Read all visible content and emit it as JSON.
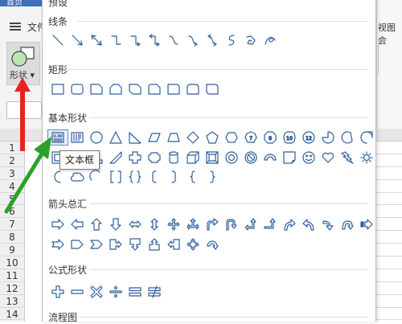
{
  "app": {
    "home_tab": "首页",
    "menu_text": "文件",
    "shape_button_label": "形状",
    "row_numbers": [
      "1",
      "2",
      "3",
      "4",
      "5",
      "6",
      "7",
      "8",
      "9",
      "10",
      "11",
      "12",
      "13",
      "14"
    ],
    "right_view_text": "视图",
    "right_extra": "会"
  },
  "panel": {
    "top_label": "预设",
    "sections": [
      {
        "title": "线条",
        "icons": [
          "line-icon",
          "arrow-line-icon",
          "double-arrow-line-icon",
          "elbow-connector-icon",
          "elbow-arrow-connector-icon",
          "elbow-double-arrow-icon",
          "curved-connector-icon",
          "curved-arrow-connector-icon",
          "curved-double-arrow-icon",
          "curve-icon",
          "freeform-icon",
          "scribble-icon"
        ]
      },
      {
        "title": "矩形",
        "icons": [
          "rectangle-icon",
          "rounded-rectangle-icon",
          "snip-corner-rectangle-icon",
          "snip-same-side-rectangle-icon",
          "snip-diagonal-rectangle-icon",
          "snip-round-rectangle-icon",
          "round-corner-rectangle-icon",
          "round-same-side-rectangle-icon",
          "round-diagonal-rectangle-icon"
        ]
      },
      {
        "title": "基本形状",
        "icons": [
          "text-box-icon",
          "vertical-text-box-icon",
          "oval-icon",
          "triangle-icon",
          "right-triangle-icon",
          "parallelogram-icon",
          "trapezoid-icon",
          "diamond-icon",
          "pentagon-icon",
          "hexagon-icon",
          "heptagon-icon",
          "octagon-icon",
          "decagon-icon",
          "dodecagon-icon",
          "pie-icon",
          "chord-icon",
          "teardrop-icon",
          "frame-icon",
          "half-frame-icon",
          "l-shape-icon",
          "diagonal-stripe-icon",
          "cross-icon",
          "plaque-icon",
          "can-icon",
          "cube-icon",
          "bevel-icon",
          "donut-icon",
          "no-symbol-icon",
          "block-arc-icon",
          "folded-corner-icon",
          "smiley-face-icon",
          "heart-icon",
          "lightning-bolt-icon",
          "sun-icon",
          "moon-icon",
          "cloud-icon",
          "arc-icon",
          "double-bracket-icon",
          "double-brace-icon",
          "left-bracket-icon",
          "right-bracket-icon",
          "left-brace-icon",
          "right-brace-icon"
        ]
      },
      {
        "title": "箭头总汇",
        "icons": []
      },
      {
        "title": "公式形状",
        "icons": []
      },
      {
        "title": "流程图",
        "icons": []
      }
    ],
    "tooltip": "文本框"
  },
  "colors": {
    "icon_stroke": "#2f5f9a",
    "annotation_red": "#e8231f",
    "annotation_green": "#2aa12a"
  }
}
